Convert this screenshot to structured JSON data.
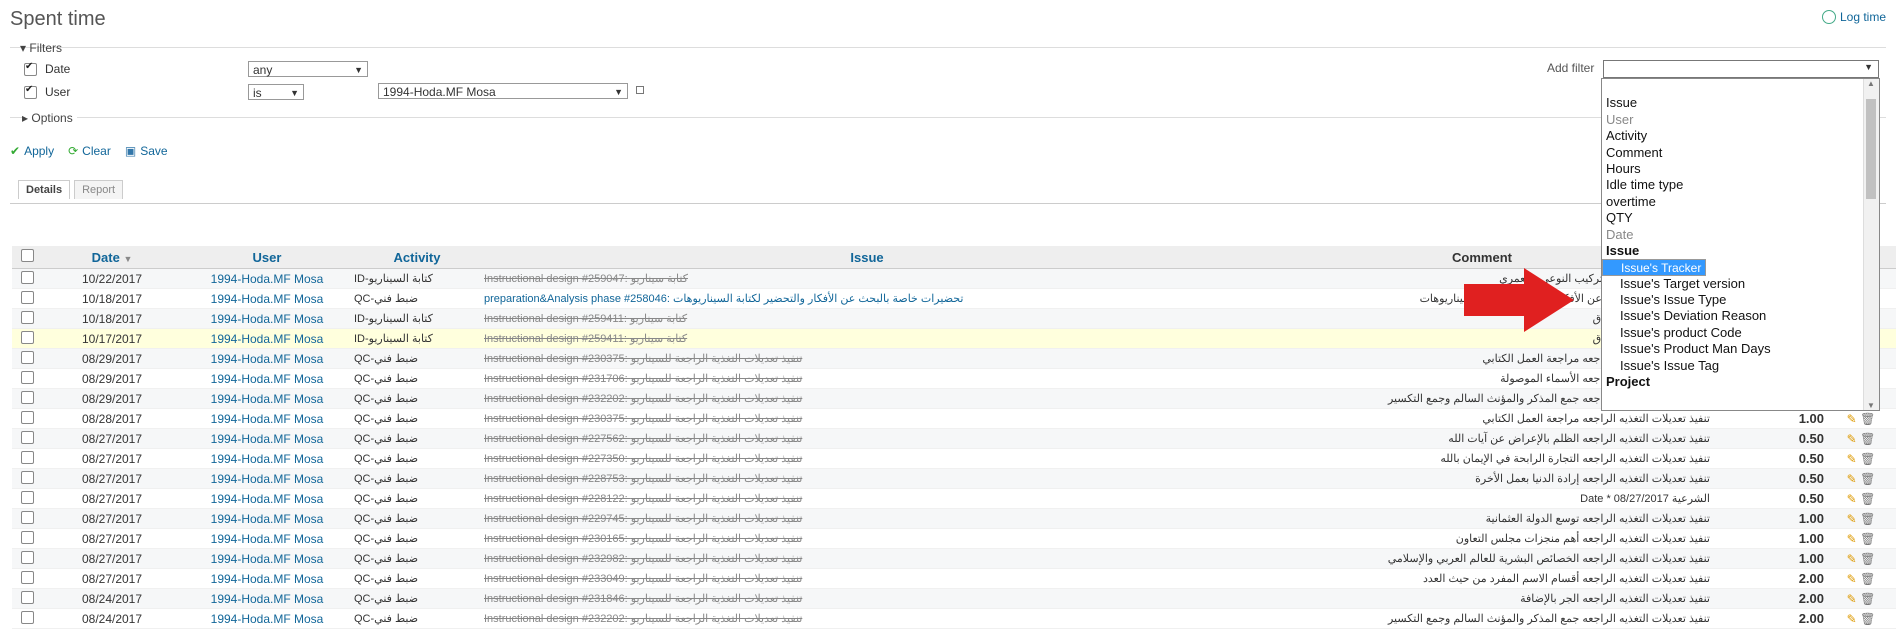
{
  "page": {
    "title": "Spent time",
    "log_time": "Log time"
  },
  "filters": {
    "legend": "Filters",
    "date": {
      "label": "Date",
      "operator": "any"
    },
    "user": {
      "label": "User",
      "operator": "is",
      "value": "1994-Hoda.MF Mosa"
    },
    "add_filter_label": "Add filter",
    "options_label": "Options"
  },
  "actions": {
    "apply": "Apply",
    "clear": "Clear",
    "save": "Save"
  },
  "tabs": {
    "details": "Details",
    "report": "Report"
  },
  "table": {
    "headers": {
      "date": "Date",
      "user": "User",
      "activity": "Activity",
      "issue": "Issue",
      "comment": "Comment"
    },
    "rows": [
      {
        "date": "10/22/2017",
        "user": "1994-Hoda.MF Mosa",
        "activity": "ID-كتابة السيناريو",
        "issue": "Instructional design #259047: كتابة سيناريو",
        "comment": "كتابة سيناريو الأنشطة التركيب النوعي والعمري",
        "hours": ""
      },
      {
        "date": "10/18/2017",
        "user": "1994-Hoda.MF Mosa",
        "activity": "QC-ضبط فني",
        "issue": "preparation&Analysis phase #258046: تحضيرات خاصة بالبحث عن الأفكار والتحضير لكتابة السيناريوهات",
        "comment": "تحضيرات خاصة بالبحث عن الأفكار والتحضير لكتابة السيناريوهات",
        "hours": ""
      },
      {
        "date": "10/18/2017",
        "user": "1994-Hoda.MF Mosa",
        "activity": "ID-كتابة السيناريو",
        "issue": "Instructional design #259411: كتابة سيناريو",
        "comment": "كتابة سيناريو غزوة الخندق",
        "hours": ""
      },
      {
        "date": "10/17/2017",
        "user": "1994-Hoda.MF Mosa",
        "activity": "ID-كتابة السيناريو",
        "issue": "Instructional design #259411: كتابة سيناريو",
        "comment": "كتابة سيناريو غزوة الخندق",
        "hours": ""
      },
      {
        "date": "08/29/2017",
        "user": "1994-Hoda.MF Mosa",
        "activity": "QC-ضبط فني",
        "issue": "Instructional design #230375: تنفيذ تعديلات التغذية الراجعة للسيناريو",
        "comment": "تنفيذ تعديلات التغذيه الراجعه مراجعة العمل الكتابي",
        "hours": ""
      },
      {
        "date": "08/29/2017",
        "user": "1994-Hoda.MF Mosa",
        "activity": "QC-ضبط فني",
        "issue": "Instructional design #231706: تنفيذ تعديلات التغذية الراجعة للسيناريو",
        "comment": "تنفيذ تعديلات التغذيه الراجعه الأسماء الموصولة",
        "hours": ""
      },
      {
        "date": "08/29/2017",
        "user": "1994-Hoda.MF Mosa",
        "activity": "QC-ضبط فني",
        "issue": "Instructional design #232202: تنفيذ تعديلات التغذية الراجعة للسيناريو",
        "comment": "تنفيذ تعديلات التغذيه الراجعه جمع المذكر والمؤنث السالم وجمع التكسير",
        "hours": ""
      },
      {
        "date": "08/28/2017",
        "user": "1994-Hoda.MF Mosa",
        "activity": "QC-ضبط فني",
        "issue": "Instructional design #230375: تنفيذ تعديلات التغذية الراجعة للسيناريو",
        "comment": "تنفيذ تعديلات التغذيه الراجعه مراجعة العمل الكتابي",
        "hours": "1.00"
      },
      {
        "date": "08/27/2017",
        "user": "1994-Hoda.MF Mosa",
        "activity": "QC-ضبط فني",
        "issue": "Instructional design #227562: تنفيذ تعديلات التغذية الراجعة للسيناريو",
        "comment": "تنفيذ تعديلات التغذيه الراجعه الظلم بالإعراض عن آيات الله",
        "hours": "0.50"
      },
      {
        "date": "08/27/2017",
        "user": "1994-Hoda.MF Mosa",
        "activity": "QC-ضبط فني",
        "issue": "Instructional design #227350: تنفيذ تعديلات التغذية الراجعة للسيناريو",
        "comment": "تنفيذ تعديلات التغذيه الراجعه التجارة الرابحة في الإيمان بالله",
        "hours": "0.50"
      },
      {
        "date": "08/27/2017",
        "user": "1994-Hoda.MF Mosa",
        "activity": "QC-ضبط فني",
        "issue": "Instructional design #228753: تنفيذ تعديلات التغذية الراجعة للسيناريو",
        "comment": "تنفيذ تعديلات التغذيه الراجعه إرادة الدنيا بعمل الأخرة",
        "hours": "0.50"
      },
      {
        "date": "08/27/2017",
        "user": "1994-Hoda.MF Mosa",
        "activity": "QC-ضبط فني",
        "issue": "Instructional design #228122: تنفيذ تعديلات التغذية الراجعة للسيناريو",
        "comment": "الشرعية Date * 08/27/2017",
        "hours": "0.50"
      },
      {
        "date": "08/27/2017",
        "user": "1994-Hoda.MF Mosa",
        "activity": "QC-ضبط فني",
        "issue": "Instructional design #229745: تنفيذ تعديلات التغذية الراجعة للسيناريو",
        "comment": "تنفيذ تعديلات التغذيه الراجعه توسع الدولة العثمانية",
        "hours": "1.00"
      },
      {
        "date": "08/27/2017",
        "user": "1994-Hoda.MF Mosa",
        "activity": "QC-ضبط فني",
        "issue": "Instructional design #230165: تنفيذ تعديلات التغذية الراجعة للسيناريو",
        "comment": "تنفيذ تعديلات التغذيه الراجعه أهم منجزات مجلس التعاون",
        "hours": "1.00"
      },
      {
        "date": "08/27/2017",
        "user": "1994-Hoda.MF Mosa",
        "activity": "QC-ضبط فني",
        "issue": "Instructional design #232982: تنفيذ تعديلات التغذية الراجعة للسيناريو",
        "comment": "تنفيذ تعديلات التغذيه الراجعه الخصائص البشرية للعالم العربي والإسلامي",
        "hours": "1.00"
      },
      {
        "date": "08/27/2017",
        "user": "1994-Hoda.MF Mosa",
        "activity": "QC-ضبط فني",
        "issue": "Instructional design #233049: تنفيذ تعديلات التغذية الراجعة للسيناريو",
        "comment": "تنفيذ تعديلات التغذيه الراجعه أقسام الاسم المفرد من حيث العدد",
        "hours": "2.00"
      },
      {
        "date": "08/24/2017",
        "user": "1994-Hoda.MF Mosa",
        "activity": "QC-ضبط فني",
        "issue": "Instructional design #231846: تنفيذ تعديلات التغذية الراجعة للسيناريو",
        "comment": "تنفيذ تعديلات التغذيه الراجعه الجر بالإضافة",
        "hours": "2.00"
      },
      {
        "date": "08/24/2017",
        "user": "1994-Hoda.MF Mosa",
        "activity": "QC-ضبط فني",
        "issue": "Instructional design #232202: تنفيذ تعديلات التغذية الراجعة للسيناريو",
        "comment": "تنفيذ تعديلات التغذيه الراجعه جمع المذكر والمؤنث السالم وجمع التكسير",
        "hours": "2.00"
      }
    ]
  },
  "dropdown_options": [
    {
      "label": "",
      "kind": "blank"
    },
    {
      "label": "Issue",
      "kind": "normal"
    },
    {
      "label": "User",
      "kind": "disabled"
    },
    {
      "label": "Activity",
      "kind": "normal"
    },
    {
      "label": "Comment",
      "kind": "normal"
    },
    {
      "label": "Hours",
      "kind": "normal"
    },
    {
      "label": "Idle time type",
      "kind": "normal"
    },
    {
      "label": "overtime",
      "kind": "normal"
    },
    {
      "label": "QTY",
      "kind": "normal"
    },
    {
      "label": "Date",
      "kind": "disabled"
    },
    {
      "label": "Issue",
      "kind": "group"
    },
    {
      "label": "Issue's Tracker",
      "kind": "selected"
    },
    {
      "label": "Issue's Status",
      "kind": "child"
    },
    {
      "label": "Issue's Target version",
      "kind": "child"
    },
    {
      "label": "Issue's Issue Type",
      "kind": "child"
    },
    {
      "label": "Issue's Deviation Reason",
      "kind": "child"
    },
    {
      "label": "Issue's product Code",
      "kind": "child"
    },
    {
      "label": "Issue's Product Man Days",
      "kind": "child"
    },
    {
      "label": "Issue's Issue Tag",
      "kind": "child"
    },
    {
      "label": "Project",
      "kind": "group"
    }
  ],
  "colors": {
    "link": "#116699",
    "selected": "#3399ff",
    "arrow": "#e02020"
  }
}
